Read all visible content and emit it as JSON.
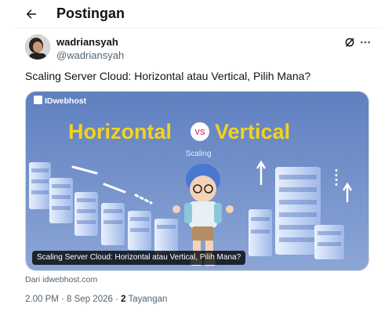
{
  "header": {
    "title": "Postingan",
    "back_icon": "arrow-left-icon"
  },
  "author": {
    "display_name": "wadriansyah",
    "handle": "@wadriansyah"
  },
  "actions": {
    "grok_icon": "grok-icon",
    "more_icon": "more-horizontal-icon"
  },
  "post": {
    "text": "Scaling Server Cloud: Horizontal atau Vertical, Pilih Mana?"
  },
  "link_card": {
    "brand": "IDwebhost",
    "headline_left": "Horizontal",
    "vs": "VS",
    "headline_right": "Vertical",
    "subtitle": "Scaling",
    "caption": "Scaling Server Cloud: Horizontal atau Vertical, Pilih Mana?",
    "source": "Dari idwebhost.com",
    "colors": {
      "headline_yellow": "#f5d21b",
      "background_blue": "#6f8fc4"
    }
  },
  "meta": {
    "time_date": "2.00 PM · 8 Sep 2026 · ",
    "views_count": "2",
    "views_label": " Tayangan"
  }
}
